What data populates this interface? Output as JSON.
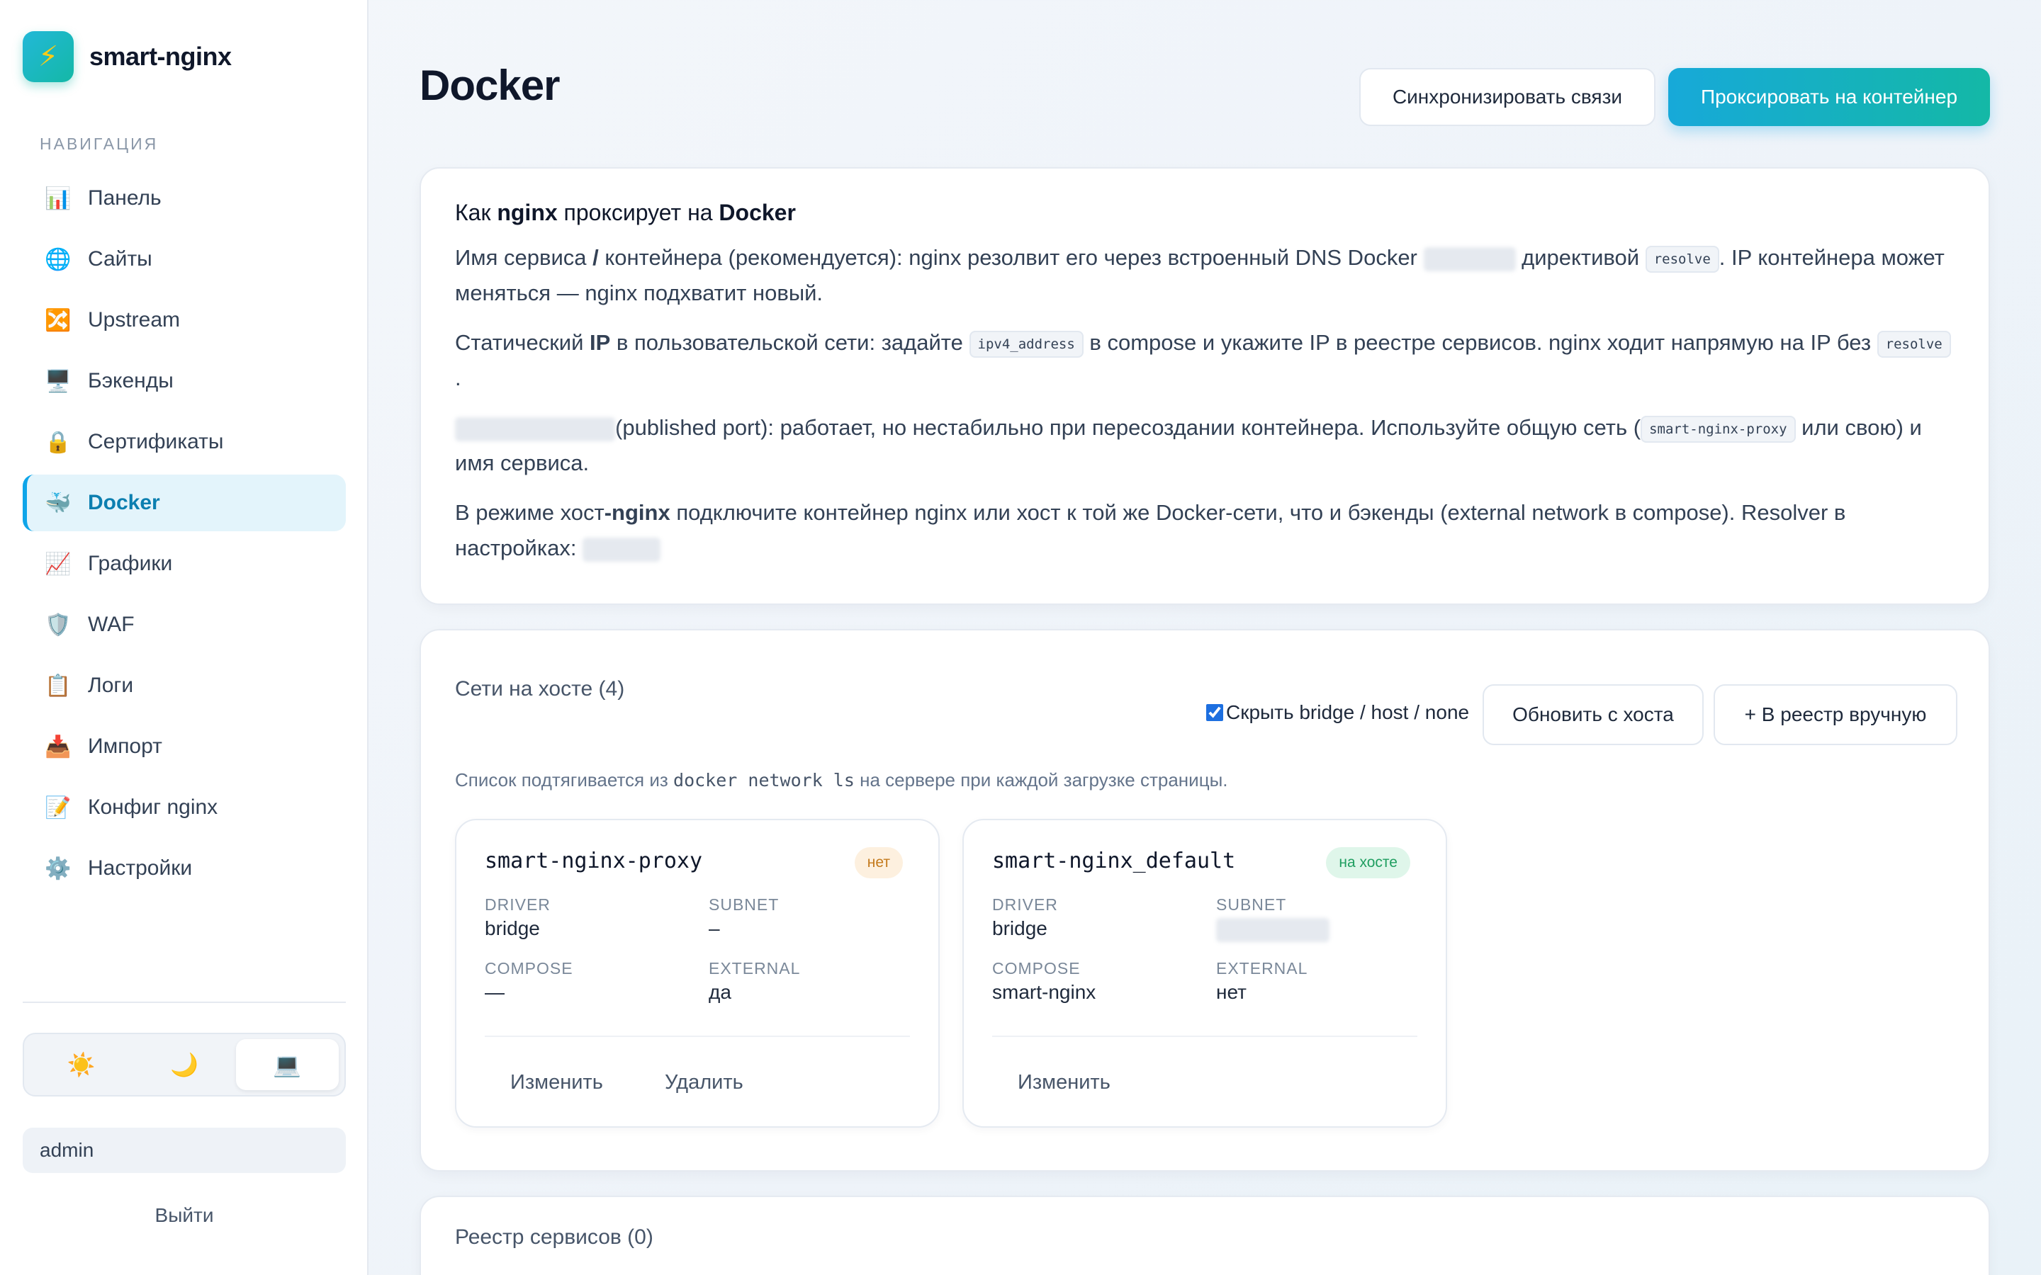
{
  "brand": {
    "name": "smart-nginx",
    "logo_icon": "bolt-icon"
  },
  "nav": {
    "heading": "НАВИГАЦИЯ",
    "items": [
      {
        "label": "Панель",
        "icon": "📊"
      },
      {
        "label": "Сайты",
        "icon": "🌐"
      },
      {
        "label": "Upstream",
        "icon": "🔀"
      },
      {
        "label": "Бэкенды",
        "icon": "🖥️"
      },
      {
        "label": "Сертификаты",
        "icon": "🔒"
      },
      {
        "label": "Docker",
        "icon": "🐳",
        "active": true
      },
      {
        "label": "Графики",
        "icon": "📈"
      },
      {
        "label": "WAF",
        "icon": "🛡️"
      },
      {
        "label": "Логи",
        "icon": "📋"
      },
      {
        "label": "Импорт",
        "icon": "📥"
      },
      {
        "label": "Конфиг nginx",
        "icon": "📝"
      },
      {
        "label": "Настройки",
        "icon": "⚙️"
      }
    ]
  },
  "theme": {
    "light": "☀️",
    "dark": "🌙",
    "system": "💻",
    "selected": "system"
  },
  "user": {
    "name": "admin",
    "logout": "Выйти"
  },
  "header": {
    "title": "Docker",
    "sync_button": "Синхронизировать связи",
    "proxy_button": "Проксировать на контейнер"
  },
  "info": {
    "title_pre": "Как ",
    "title_b1": "nginx",
    "title_mid": " проксирует на ",
    "title_b2": "Docker",
    "p1_a": "Имя сервиса ",
    "p1_b": "/",
    "p1_c": " контейнера (рекомендуется): nginx резолвит его через встроенный DNS Docker ",
    "p1_d": " директивой ",
    "p1_code": "resolve",
    "p1_e": ". IP контейнера может меняться — nginx подхватит новый.",
    "p2_a": "Статический ",
    "p2_b": "IP",
    "p2_c": " в пользовательской сети: задайте ",
    "p2_code1": "ipv4_address",
    "p2_d": " в compose и укажите IP в реестре сервисов. nginx ходит напрямую на IP без ",
    "p2_code2": "resolve",
    "p2_e": ".",
    "p3_a": "(published port): работает, но нестабильно при пересоздании контейнера. Используйте общую сеть (",
    "p3_code": "smart-nginx-proxy",
    "p3_b": " или свою) и имя сервиса.",
    "p4_a": "В режиме хост",
    "p4_b": "-nginx",
    "p4_c": " подключите контейнер nginx или хост к той же Docker-сети, что и бэкенды (external network в compose). Resolver в настройках: "
  },
  "networks": {
    "title": "Сети на хосте (4)",
    "hide_label": "Скрыть bridge / host / none",
    "hide_checked": true,
    "refresh_button": "Обновить с хоста",
    "add_button": "+ В реестр вручную",
    "desc_pre": "Список подтягивается из ",
    "desc_code": "docker network ls",
    "desc_post": " на сервере при каждой загрузке страницы.",
    "labels": {
      "driver": "DRIVER",
      "subnet": "SUBNET",
      "compose": "COMPOSE",
      "external": "EXTERNAL"
    },
    "items": [
      {
        "name": "smart-nginx-proxy",
        "badge": "нет",
        "driver": "bridge",
        "subnet": "–",
        "compose": "—",
        "external": "да",
        "edit": "Изменить",
        "delete": "Удалить"
      },
      {
        "name": "smart-nginx_default",
        "badge": "на хосте",
        "driver": "bridge",
        "subnet": "",
        "compose": "smart-nginx",
        "external": "нет",
        "edit": "Изменить"
      }
    ]
  },
  "registry": {
    "title": "Реестр сервисов (0)"
  }
}
